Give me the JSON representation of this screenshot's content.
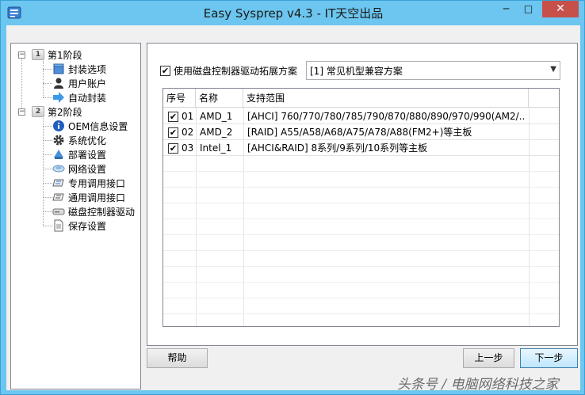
{
  "window": {
    "title": "Easy Sysprep v4.3 - IT天空出品"
  },
  "titlebar_buttons": {
    "minimize": "─",
    "maximize": "□",
    "close": "✕"
  },
  "tree": {
    "stage1": {
      "badge": "1",
      "label": "第1阶段"
    },
    "stage1_items": [
      {
        "label": "封装选项",
        "icon": "package-icon"
      },
      {
        "label": "用户账户",
        "icon": "user-icon"
      },
      {
        "label": "自动封装",
        "icon": "arrow-right-icon"
      }
    ],
    "stage2": {
      "badge": "2",
      "label": "第2阶段"
    },
    "stage2_items": [
      {
        "label": "OEM信息设置",
        "icon": "info-icon"
      },
      {
        "label": "系统优化",
        "icon": "gear-icon"
      },
      {
        "label": "部署设置",
        "icon": "deploy-icon"
      },
      {
        "label": "网络设置",
        "icon": "network-icon"
      },
      {
        "label": "专用调用接口",
        "icon": "interface-icon"
      },
      {
        "label": "通用调用接口",
        "icon": "interface-icon"
      },
      {
        "label": "磁盘控制器驱动",
        "icon": "disk-icon"
      },
      {
        "label": "保存设置",
        "icon": "document-icon"
      }
    ]
  },
  "main": {
    "enable_checkbox": {
      "label": "使用磁盘控制器驱动拓展方案",
      "checked": true
    },
    "scheme_select": {
      "value": "[1] 常见机型兼容方案"
    },
    "table": {
      "headers": [
        "序号",
        "名称",
        "支持范围"
      ],
      "rows": [
        {
          "checked": true,
          "index": "01",
          "name": "AMD_1",
          "range": "[AHCI] 760/770/780/785/790/870/880/890/970/990(AM2/..."
        },
        {
          "checked": true,
          "index": "02",
          "name": "AMD_2",
          "range": "[RAID] A55/A58/A68/A75/A78/A88(FM2+)等主板"
        },
        {
          "checked": true,
          "index": "03",
          "name": "Intel_1",
          "range": "[AHCI&RAID] 8系列/9系列/10系列等主板"
        }
      ]
    }
  },
  "buttons": {
    "help": "帮助",
    "prev": "上一步",
    "next": "下一步"
  },
  "watermark": "头条号 / 电脑网络科技之家",
  "colors": {
    "window_frame": "#6cc6ef",
    "close_button": "#c7514a",
    "selected_button": "#bee6fd"
  }
}
